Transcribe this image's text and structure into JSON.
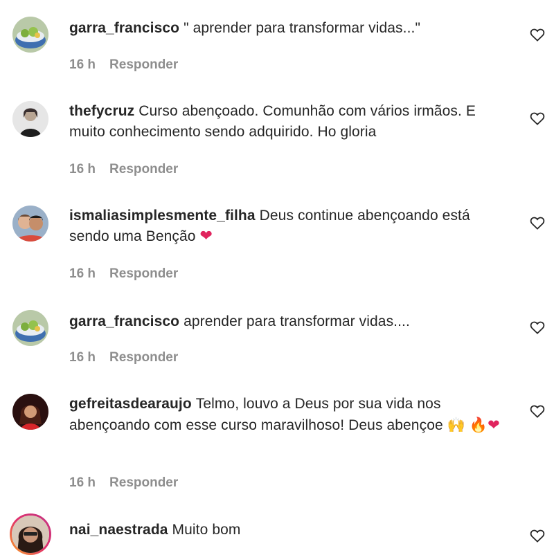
{
  "comments": [
    {
      "username": "garra_francisco",
      "text": "\" aprender para transformar vidas...\"",
      "time": "16 h",
      "reply_label": "Responder",
      "avatar_icon": "salad-bowl-avatar"
    },
    {
      "username": "thefycruz",
      "text": "Curso abençoado. Comunhão com vários irmãos. E muito conhecimento sendo adquirido. Ho gloria",
      "time": "16 h",
      "reply_label": "Responder",
      "avatar_icon": "person-avatar"
    },
    {
      "username": "ismaliasimplesmente_filha",
      "text": "Deus continue abençoando está sendo uma Benção",
      "emoji": "❤",
      "time": "16 h",
      "reply_label": "Responder",
      "avatar_icon": "couple-avatar"
    },
    {
      "username": "garra_francisco",
      "text": "aprender para transformar vidas....",
      "time": "16 h",
      "reply_label": "Responder",
      "avatar_icon": "salad-bowl-avatar"
    },
    {
      "username": "gefreitasdearaujo",
      "text": "Telmo, louvo a Deus por sua vida nos abençoando com esse curso maravilhoso! Deus abençoe",
      "emoji_line1": "🙌",
      "emoji_line2": "🔥❤",
      "time": "16 h",
      "reply_label": "Responder",
      "avatar_icon": "woman-avatar"
    },
    {
      "username": "nai_naestrada",
      "text": "Muito bom",
      "avatar_icon": "woman-smiling-avatar"
    }
  ],
  "icons": {
    "like": "heart-outline-icon"
  },
  "colors": {
    "muted": "#8e8e8e",
    "text": "#262626",
    "heart_red": "#e0245e"
  }
}
